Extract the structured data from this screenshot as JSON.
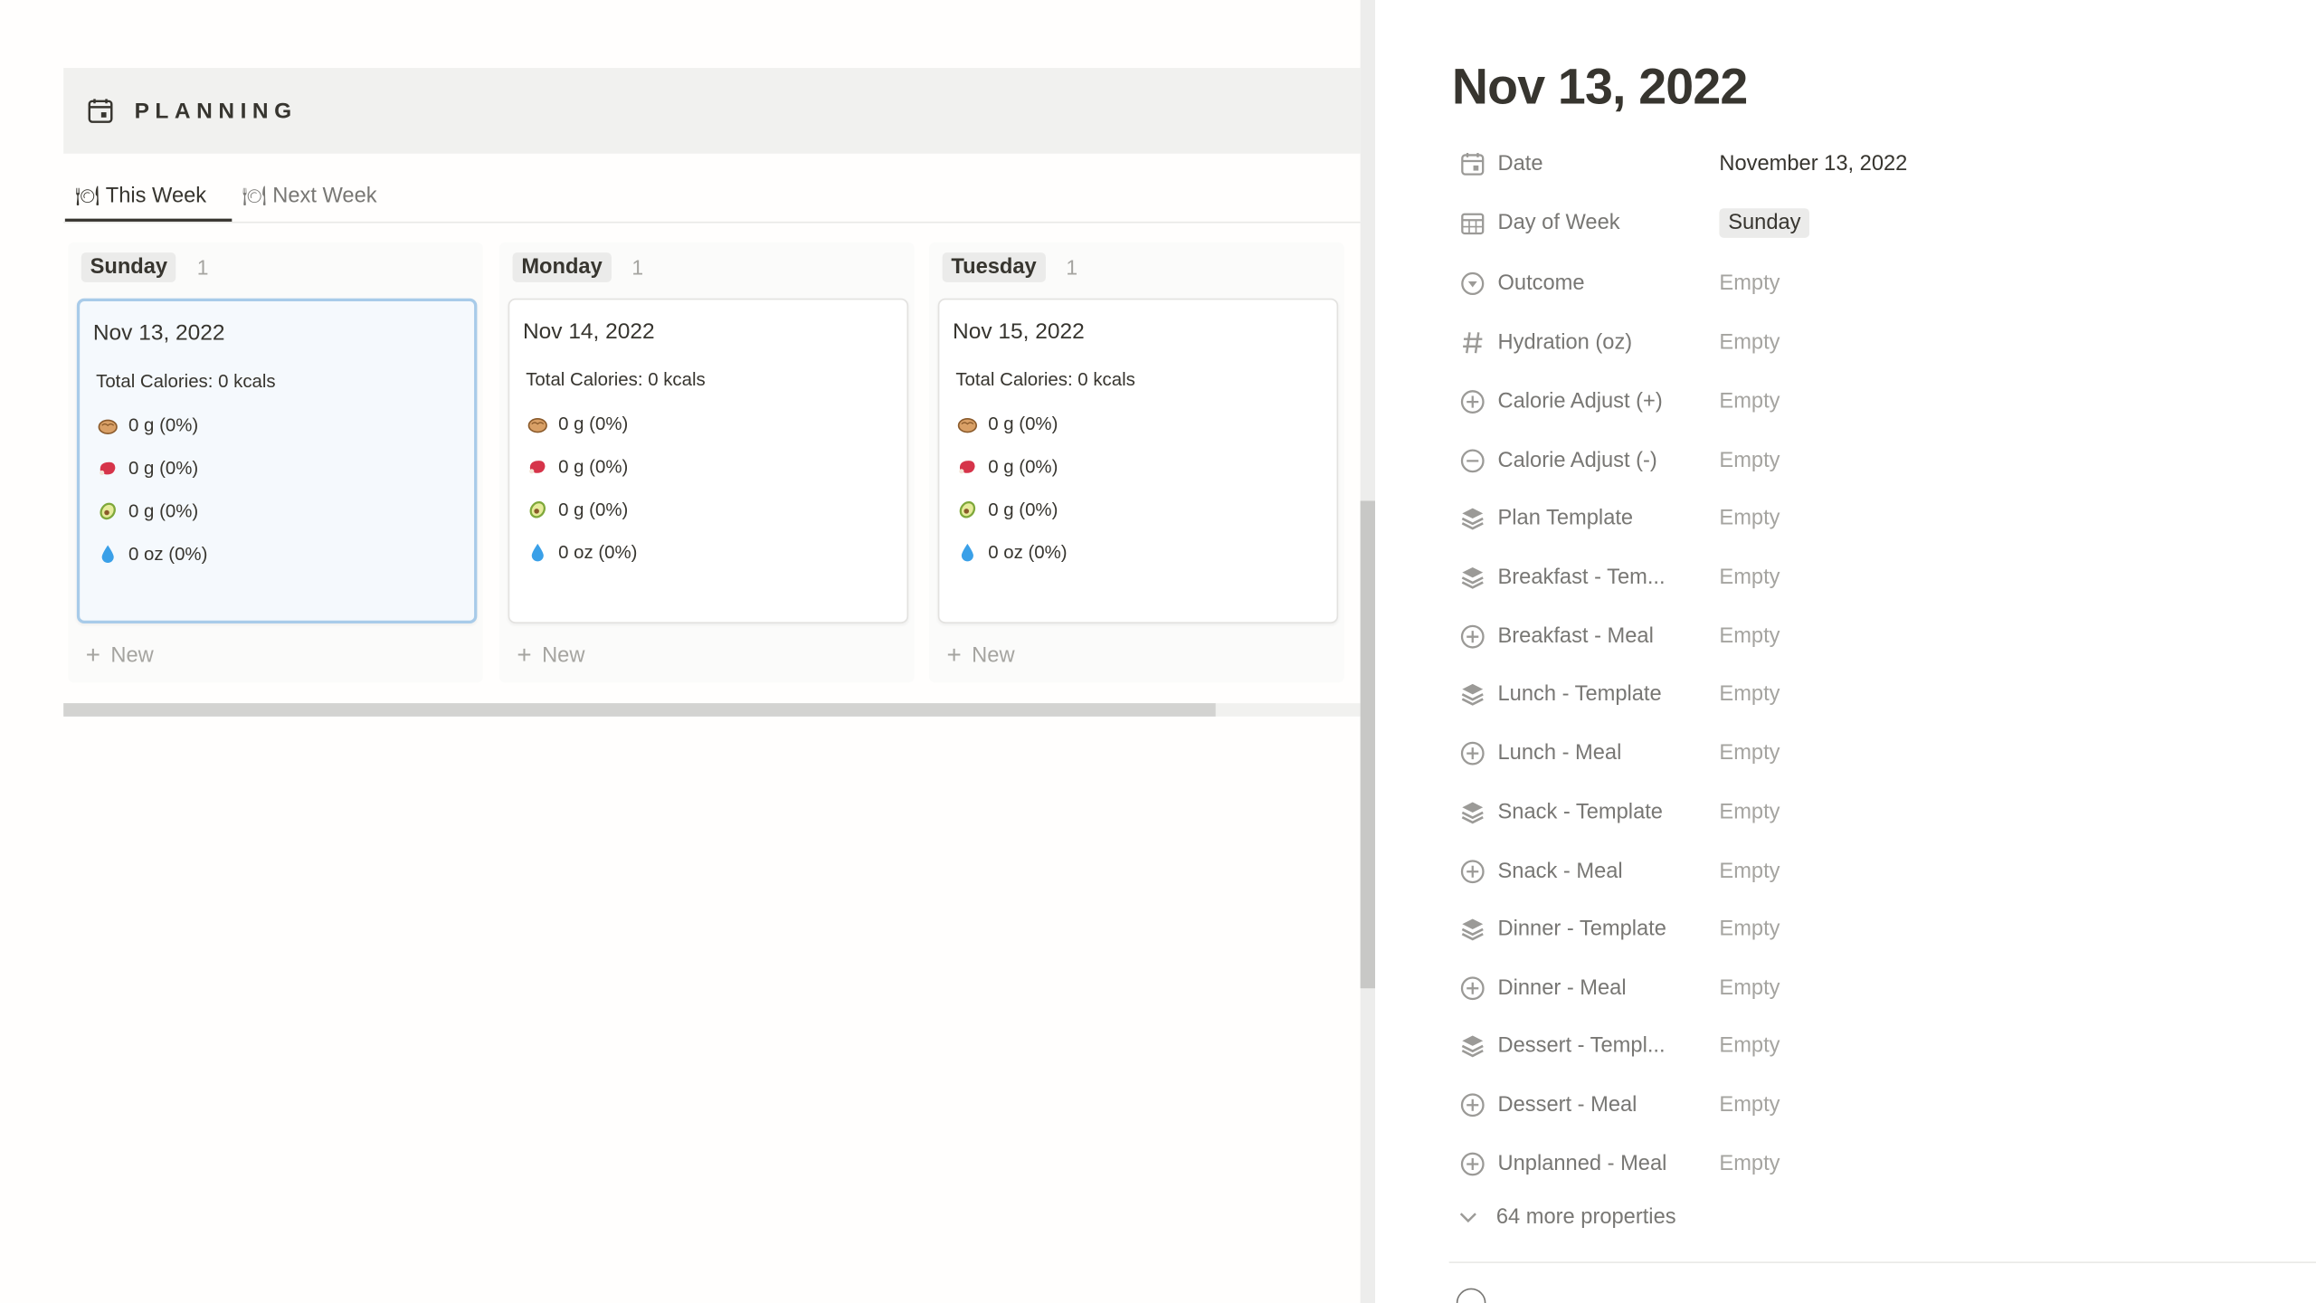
{
  "board": {
    "title": "PLANNING",
    "tabs": [
      {
        "label": "This Week",
        "glyph": "🍽"
      },
      {
        "label": "Next Week",
        "glyph": "🍽"
      }
    ],
    "columns": [
      {
        "day": "Sunday",
        "count": "1",
        "card": {
          "title": "Nov 13, 2022",
          "calories": "Total Calories: 0 kcals",
          "carbs": "0 g (0%)",
          "protein": "0 g (0%)",
          "fat": "0 g (0%)",
          "water": "0 oz (0%)"
        },
        "new_label": "New"
      },
      {
        "day": "Monday",
        "count": "1",
        "card": {
          "title": "Nov 14, 2022",
          "calories": "Total Calories: 0 kcals",
          "carbs": "0 g (0%)",
          "protein": "0 g (0%)",
          "fat": "0 g (0%)",
          "water": "0 oz (0%)"
        },
        "new_label": "New"
      },
      {
        "day": "Tuesday",
        "count": "1",
        "card": {
          "title": "Nov 15, 2022",
          "calories": "Total Calories: 0 kcals",
          "carbs": "0 g (0%)",
          "protein": "0 g (0%)",
          "fat": "0 g (0%)",
          "water": "0 oz (0%)"
        },
        "new_label": "New"
      }
    ]
  },
  "panel": {
    "title": "Nov 13, 2022",
    "properties": [
      {
        "icon": "calendar-icon",
        "name": "Date",
        "value": "November 13, 2022"
      },
      {
        "icon": "calendar-grid-icon",
        "name": "Day of Week",
        "value": "Sunday"
      },
      {
        "icon": "status-icon",
        "name": "Outcome",
        "value": "Empty"
      },
      {
        "icon": "number-icon",
        "name": "Hydration (oz)",
        "value": "Empty"
      },
      {
        "icon": "plus-circle-icon",
        "name": "Calorie Adjust (+)",
        "value": "Empty"
      },
      {
        "icon": "minus-circle-icon",
        "name": "Calorie Adjust (-)",
        "value": "Empty"
      },
      {
        "icon": "rollup-icon",
        "name": "Plan Template",
        "value": "Empty"
      },
      {
        "icon": "rollup-icon",
        "name": "Breakfast - Tem...",
        "value": "Empty"
      },
      {
        "icon": "relation-icon",
        "name": "Breakfast - Meal",
        "value": "Empty"
      },
      {
        "icon": "rollup-icon",
        "name": "Lunch - Template",
        "value": "Empty"
      },
      {
        "icon": "relation-icon",
        "name": "Lunch - Meal",
        "value": "Empty"
      },
      {
        "icon": "rollup-icon",
        "name": "Snack - Template",
        "value": "Empty"
      },
      {
        "icon": "relation-icon",
        "name": "Snack - Meal",
        "value": "Empty"
      },
      {
        "icon": "rollup-icon",
        "name": "Dinner - Template",
        "value": "Empty"
      },
      {
        "icon": "relation-icon",
        "name": "Dinner - Meal",
        "value": "Empty"
      },
      {
        "icon": "rollup-icon",
        "name": "Dessert - Templ...",
        "value": "Empty"
      },
      {
        "icon": "relation-icon",
        "name": "Dessert - Meal",
        "value": "Empty"
      },
      {
        "icon": "relation-icon",
        "name": "Unplanned - Meal",
        "value": "Empty"
      }
    ],
    "more_label": "64 more properties"
  }
}
